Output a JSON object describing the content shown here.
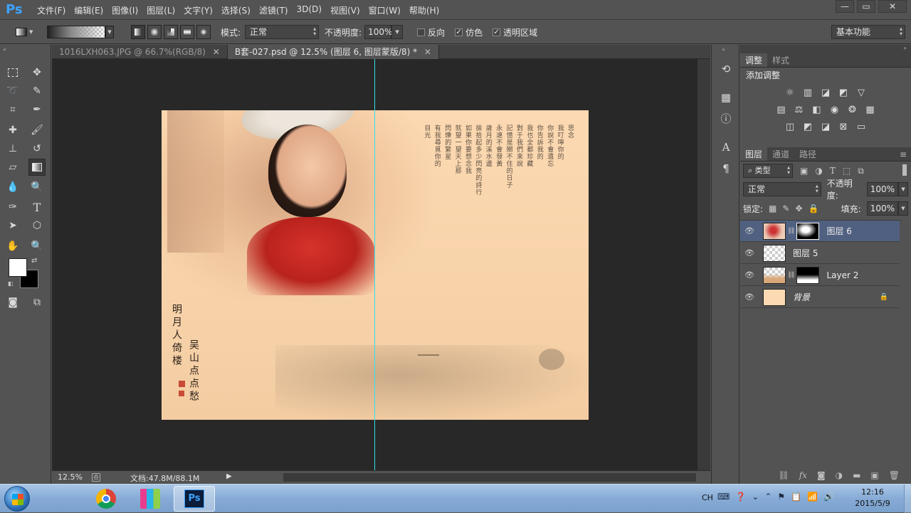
{
  "app": {
    "logo": "Ps"
  },
  "menu": [
    "文件(F)",
    "编辑(E)",
    "图像(I)",
    "图层(L)",
    "文字(Y)",
    "选择(S)",
    "滤镜(T)",
    "3D(D)",
    "视图(V)",
    "窗口(W)",
    "帮助(H)"
  ],
  "window_buttons": {
    "minimize": "—",
    "restore": "▭",
    "close": "✕"
  },
  "options": {
    "mode_label": "模式:",
    "mode_value": "正常",
    "opacity_label": "不透明度:",
    "opacity_value": "100%",
    "reverse_label": "反向",
    "reverse_checked": false,
    "dither_label": "仿色",
    "dither_checked": true,
    "transparency_label": "透明区域",
    "transparency_checked": true,
    "workspace": "基本功能"
  },
  "tabs": [
    {
      "label": "1016LXH063.JPG @ 66.7%(RGB/8)",
      "active": false
    },
    {
      "label": "B套-027.psd @ 12.5% (图层 6, 图层蒙版/8) *",
      "active": true
    }
  ],
  "status": {
    "zoom": "12.5%",
    "doc": "文档:47.8M/88.1M"
  },
  "artboard": {
    "calligraphy_left": "明月人倚楼",
    "calligraphy_right": "吴山点点愁",
    "poem_columns": [
      "思念",
      "我叮嚀你的",
      "你說不會遺忘",
      "你告訴我的",
      "我也全都珍藏",
      "對于我們來說",
      "記憶是關不住的日子",
      "永遠不會發黃",
      "歲月的溪水邊",
      "撿拾起多少閃亮的詩行",
      "如果你要想念我",
      "就望一望天上那",
      "閃爍的繁星",
      "有我尋覓你的",
      "目光"
    ]
  },
  "right_panel": {
    "adj_tabs": [
      "调整",
      "样式"
    ],
    "add_adjustment": "添加调整",
    "adj_icons_row1": [
      "brightness-icon",
      "levels-icon",
      "curves-icon",
      "exposure-icon",
      "vibrance-icon"
    ],
    "adj_icons_row2": [
      "hue-icon",
      "color-balance-icon",
      "bw-icon",
      "photo-filter-icon",
      "channel-mixer-icon",
      "color-lookup-icon"
    ],
    "adj_icons_row3": [
      "invert-icon",
      "posterize-icon",
      "threshold-icon",
      "selective-color-icon",
      "gradient-map-icon"
    ],
    "layer_tabs": [
      "图层",
      "通道",
      "路径"
    ],
    "filter_kind": "类型",
    "blend_mode": "正常",
    "opacity_label": "不透明度:",
    "opacity_value": "100%",
    "lock_label": "锁定:",
    "fill_label": "填充:",
    "fill_value": "100%",
    "layers": [
      {
        "name": "图层 6",
        "selected": true
      },
      {
        "name": "图层 5",
        "selected": false
      },
      {
        "name": "Layer 2",
        "selected": false
      },
      {
        "name": "背景",
        "selected": false
      }
    ]
  },
  "taskbar": {
    "lang": "CH",
    "time": "12:16",
    "date": "2015/5/9"
  }
}
